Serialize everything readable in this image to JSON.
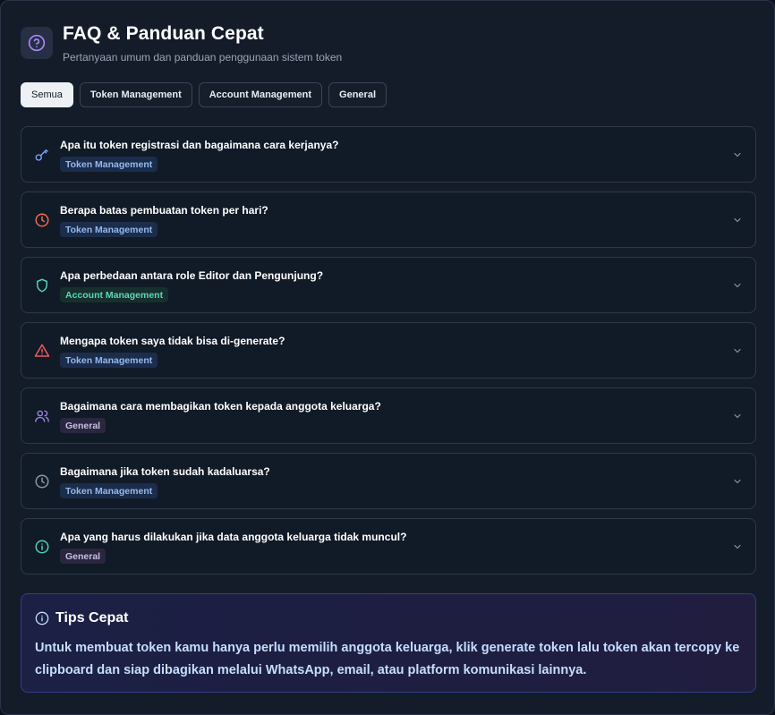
{
  "header": {
    "icon": "help-circle-icon",
    "title": "FAQ & Panduan Cepat",
    "subtitle": "Pertanyaan umum dan panduan penggunaan sistem token"
  },
  "tabs": [
    {
      "label": "Semua",
      "active": true
    },
    {
      "label": "Token Management",
      "active": false
    },
    {
      "label": "Account Management",
      "active": false
    },
    {
      "label": "General",
      "active": false
    }
  ],
  "faqs": [
    {
      "question": "Apa itu token registrasi dan bagaimana cara kerjanya?",
      "category": "Token Management",
      "icon": "key-icon",
      "icon_color": "#7aa7ff"
    },
    {
      "question": "Berapa batas pembuatan token per hari?",
      "category": "Token Management",
      "icon": "clock-icon",
      "icon_color": "#f26a4f"
    },
    {
      "question": "Apa perbedaan antara role Editor dan Pengunjung?",
      "category": "Account Management",
      "icon": "shield-icon",
      "icon_color": "#4fd1b0"
    },
    {
      "question": "Mengapa token saya tidak bisa di-generate?",
      "category": "Token Management",
      "icon": "warning-triangle-icon",
      "icon_color": "#f05a5a"
    },
    {
      "question": "Bagaimana cara membagikan token kepada anggota keluarga?",
      "category": "General",
      "icon": "users-icon",
      "icon_color": "#a685f5"
    },
    {
      "question": "Bagaimana jika token sudah kadaluarsa?",
      "category": "Token Management",
      "icon": "clock-icon",
      "icon_color": "#8d95a5"
    },
    {
      "question": "Apa yang harus dilakukan jika data anggota keluarga tidak muncul?",
      "category": "General",
      "icon": "info-circle-icon",
      "icon_color": "#4fd1b0"
    }
  ],
  "tips": {
    "icon": "info-circle-icon",
    "title": "Tips Cepat",
    "body": "Untuk membuat token kamu hanya perlu memilih anggota keluarga, klik generate token lalu token akan tercopy ke clipboard dan siap dibagikan melalui WhatsApp, email, atau platform komunikasi lainnya."
  },
  "colors": {
    "accent_purple": "#a685f5",
    "badge_token_text": "#93b9f0",
    "badge_account_text": "#5fd6b4",
    "badge_general_text": "#c7c1e0",
    "tips_text": "#c5ddff"
  }
}
